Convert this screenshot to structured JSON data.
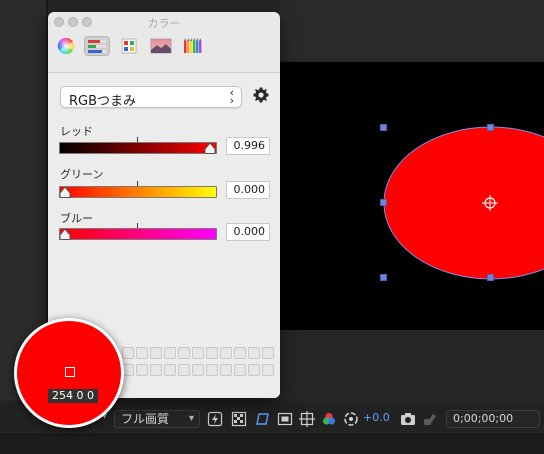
{
  "panel": {
    "title": "カラー",
    "modes": [
      "color-wheel",
      "color-sliders",
      "color-palettes",
      "image-palettes",
      "pencils"
    ],
    "popup_value": "RGBつまみ"
  },
  "sliders": [
    {
      "label": "レッド",
      "value_text": "0.996",
      "value": 0.996,
      "gradient": [
        "#000000",
        "#ff0000"
      ]
    },
    {
      "label": "グリーン",
      "value_text": "0.000",
      "value": 0.0,
      "gradient": [
        "#ff0000",
        "#ffff00"
      ]
    },
    {
      "label": "ブルー",
      "value_text": "0.000",
      "value": 0.0,
      "gradient": [
        "#ff0000",
        "#ff00ff"
      ]
    }
  ],
  "magnifier": {
    "readout": "254 0 0",
    "color": "#ff0000"
  },
  "toolbar": {
    "quality": "フル画質",
    "exposure_offset": "+0.0",
    "timecode": "0;00;00;00"
  },
  "colors": {
    "ellipse_fill": "#ff0000",
    "handle": "#6c86e0",
    "accent": "#5aa0ff"
  }
}
